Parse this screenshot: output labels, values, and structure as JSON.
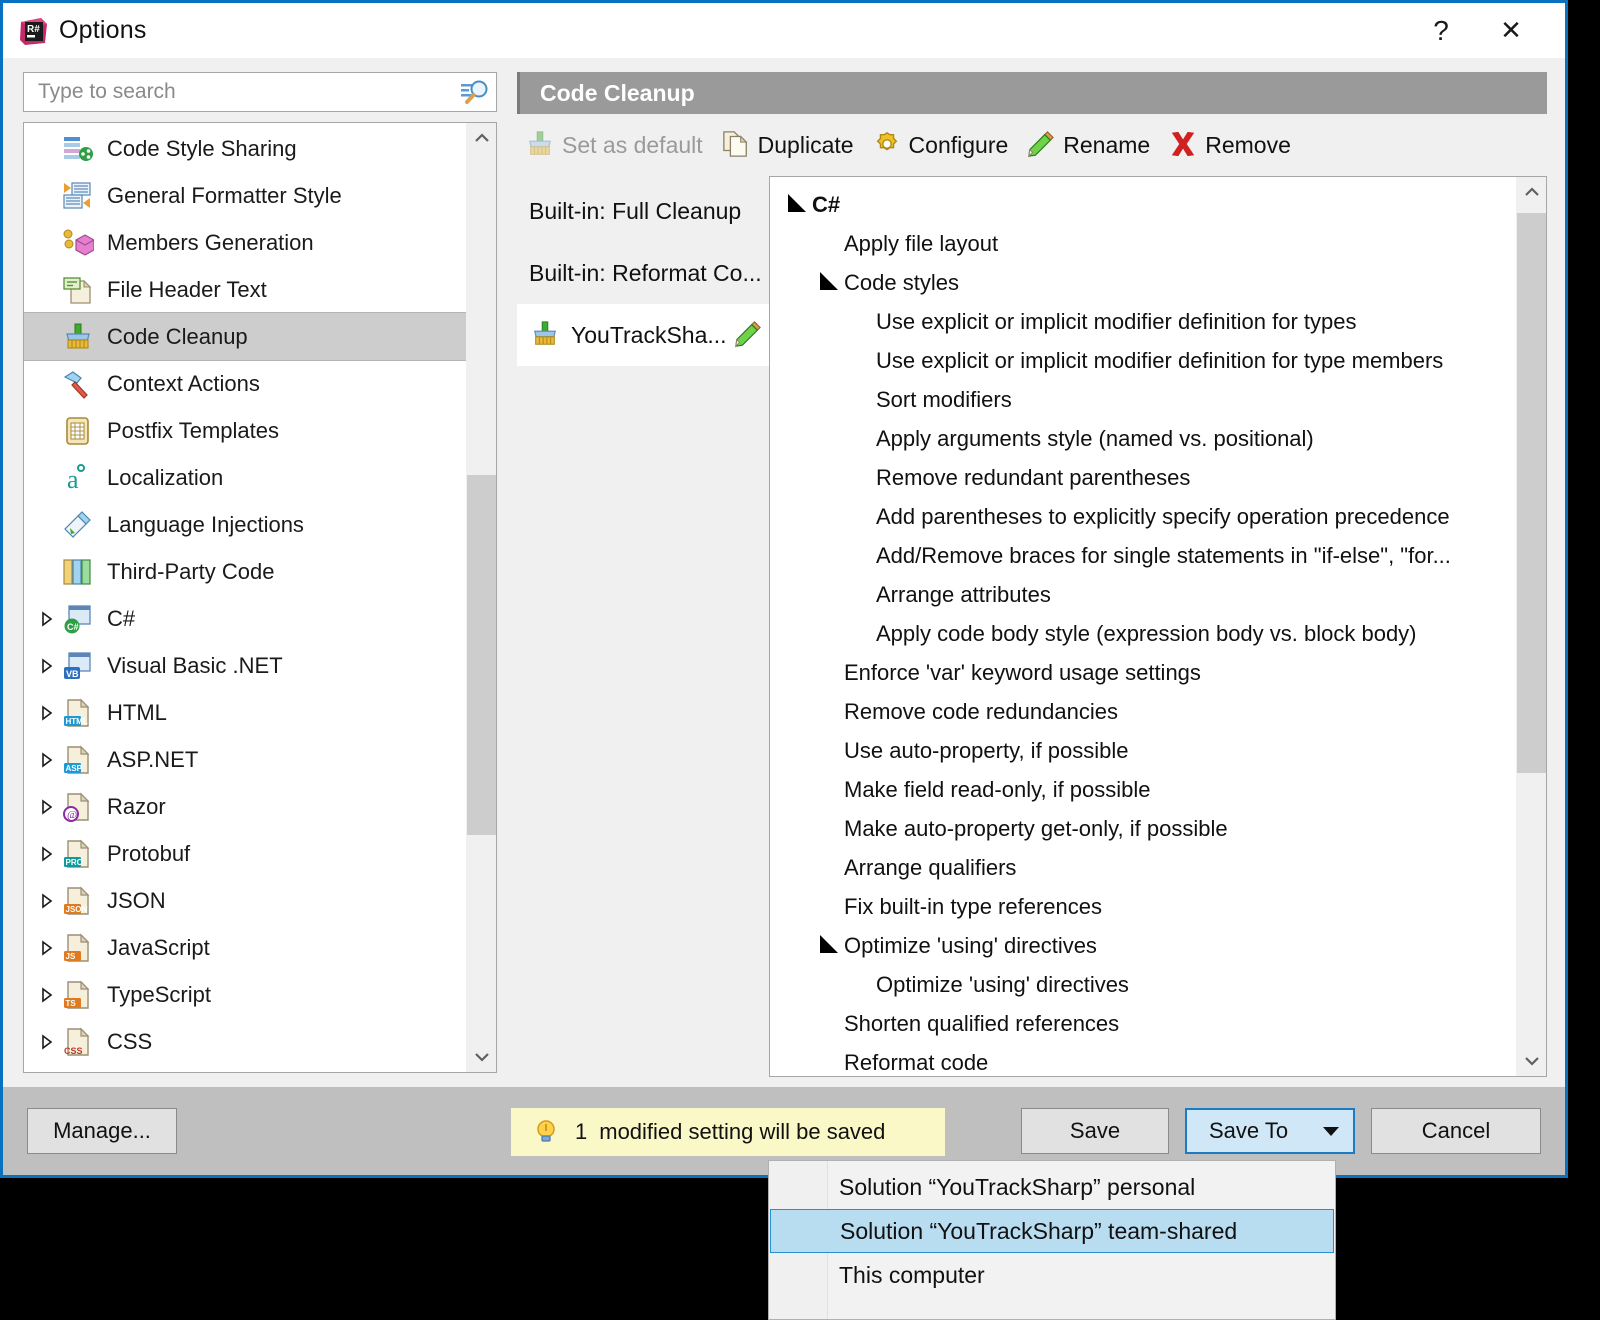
{
  "window": {
    "title": "Options",
    "app_icon": "resharper-logo-icon",
    "help_label": "?",
    "close_label": "✕",
    "border_color": "#0a70c0"
  },
  "search": {
    "placeholder": "Type to search",
    "value": "",
    "icon": "search-icon"
  },
  "sidebar": {
    "items": [
      {
        "label": "Code Style Sharing",
        "icon": "code-style-sharing-icon",
        "expandable": false,
        "selected": false
      },
      {
        "label": "General Formatter Style",
        "icon": "general-formatter-style-icon",
        "expandable": false,
        "selected": false
      },
      {
        "label": "Members Generation",
        "icon": "members-generation-icon",
        "expandable": false,
        "selected": false
      },
      {
        "label": "File Header Text",
        "icon": "file-header-text-icon",
        "expandable": false,
        "selected": false
      },
      {
        "label": "Code Cleanup",
        "icon": "code-cleanup-broom-icon",
        "expandable": false,
        "selected": true
      },
      {
        "label": "Context Actions",
        "icon": "context-actions-hammer-icon",
        "expandable": false,
        "selected": false
      },
      {
        "label": "Postfix Templates",
        "icon": "postfix-templates-icon",
        "expandable": false,
        "selected": false
      },
      {
        "label": "Localization",
        "icon": "localization-icon",
        "expandable": false,
        "selected": false
      },
      {
        "label": "Language Injections",
        "icon": "language-injections-icon",
        "expandable": false,
        "selected": false
      },
      {
        "label": "Third-Party Code",
        "icon": "third-party-code-icon",
        "expandable": false,
        "selected": false
      },
      {
        "label": "C#",
        "icon": "csharp-file-icon",
        "expandable": true,
        "selected": false
      },
      {
        "label": "Visual Basic .NET",
        "icon": "vb-file-icon",
        "expandable": true,
        "selected": false
      },
      {
        "label": "HTML",
        "icon": "html-file-icon",
        "expandable": true,
        "selected": false
      },
      {
        "label": "ASP.NET",
        "icon": "asp-file-icon",
        "expandable": true,
        "selected": false
      },
      {
        "label": "Razor",
        "icon": "razor-file-icon",
        "expandable": true,
        "selected": false
      },
      {
        "label": "Protobuf",
        "icon": "protobuf-file-icon",
        "expandable": true,
        "selected": false
      },
      {
        "label": "JSON",
        "icon": "json-file-icon",
        "expandable": true,
        "selected": false
      },
      {
        "label": "JavaScript",
        "icon": "javascript-file-icon",
        "expandable": true,
        "selected": false
      },
      {
        "label": "TypeScript",
        "icon": "typescript-file-icon",
        "expandable": true,
        "selected": false
      },
      {
        "label": "CSS",
        "icon": "css-file-icon",
        "expandable": true,
        "selected": false
      }
    ],
    "scroll": {
      "up_arrow": "▲",
      "down_arrow": "▼"
    }
  },
  "page": {
    "header_title": "Code Cleanup",
    "toolbar": [
      {
        "label": "Set as default",
        "icon": "broom-icon",
        "disabled": true
      },
      {
        "label": "Duplicate",
        "icon": "duplicate-pages-icon",
        "disabled": false
      },
      {
        "label": "Configure",
        "icon": "gear-icon",
        "disabled": false
      },
      {
        "label": "Rename",
        "icon": "pencil-icon",
        "disabled": false
      },
      {
        "label": "Remove",
        "icon": "red-x-icon",
        "disabled": false
      }
    ],
    "profiles": [
      {
        "label": "Built-in: Full Cleanup",
        "icon": null,
        "selected": false,
        "editable": false
      },
      {
        "label": "Built-in: Reformat Co...",
        "icon": null,
        "selected": false,
        "editable": false
      },
      {
        "label": "YouTrackSha...",
        "icon": "code-cleanup-broom-icon",
        "selected": true,
        "editable": true,
        "edit_icon": "pencil-icon"
      }
    ],
    "settings_tree": [
      {
        "label": "C#",
        "level": 0,
        "expander": "down",
        "bold": true
      },
      {
        "label": "Apply file layout",
        "level": 1,
        "expander": null,
        "bold": false
      },
      {
        "label": "Code styles",
        "level": 1,
        "expander": "down",
        "bold": false
      },
      {
        "label": "Use explicit or implicit modifier definition for types",
        "level": 2,
        "expander": null,
        "bold": false
      },
      {
        "label": "Use explicit or implicit modifier definition for type members",
        "level": 2,
        "expander": null,
        "bold": false
      },
      {
        "label": "Sort modifiers",
        "level": 2,
        "expander": null,
        "bold": false
      },
      {
        "label": "Apply arguments style (named vs. positional)",
        "level": 2,
        "expander": null,
        "bold": false
      },
      {
        "label": "Remove redundant parentheses",
        "level": 2,
        "expander": null,
        "bold": false
      },
      {
        "label": "Add parentheses to explicitly specify operation precedence",
        "level": 2,
        "expander": null,
        "bold": false
      },
      {
        "label": "Add/Remove braces for single statements in \"if-else\", \"for...",
        "level": 2,
        "expander": null,
        "bold": false
      },
      {
        "label": "Arrange attributes",
        "level": 2,
        "expander": null,
        "bold": false
      },
      {
        "label": "Apply code body style (expression body vs. block body)",
        "level": 2,
        "expander": null,
        "bold": false
      },
      {
        "label": "Enforce 'var' keyword usage settings",
        "level": 1,
        "expander": null,
        "bold": false
      },
      {
        "label": "Remove code redundancies",
        "level": 1,
        "expander": null,
        "bold": false
      },
      {
        "label": "Use auto-property, if possible",
        "level": 1,
        "expander": null,
        "bold": false
      },
      {
        "label": "Make field read-only, if possible",
        "level": 1,
        "expander": null,
        "bold": false
      },
      {
        "label": "Make auto-property get-only, if possible",
        "level": 1,
        "expander": null,
        "bold": false
      },
      {
        "label": "Arrange qualifiers",
        "level": 1,
        "expander": null,
        "bold": false
      },
      {
        "label": "Fix built-in type references",
        "level": 1,
        "expander": null,
        "bold": false
      },
      {
        "label": "Optimize 'using' directives",
        "level": 1,
        "expander": "down",
        "bold": false
      },
      {
        "label": "Optimize 'using' directives",
        "level": 2,
        "expander": null,
        "bold": false
      },
      {
        "label": "Shorten qualified references",
        "level": 1,
        "expander": null,
        "bold": false
      },
      {
        "label": "Reformat code",
        "level": 1,
        "expander": null,
        "bold": false
      }
    ]
  },
  "footer": {
    "manage_label": "Manage...",
    "notice": {
      "count": "1",
      "text": "modified setting will be saved",
      "icon": "lightbulb-icon",
      "background": "#fbf8c8"
    },
    "save_label": "Save",
    "save_to_label": "Save To",
    "save_to_caret": "chevron-down-icon",
    "cancel_label": "Cancel"
  },
  "dropdown": {
    "items": [
      {
        "label": "Solution “YouTrackSharp” personal",
        "selected": false
      },
      {
        "label": "Solution “YouTrackSharp” team-shared",
        "selected": true
      },
      {
        "label": "This computer",
        "selected": false
      }
    ]
  }
}
